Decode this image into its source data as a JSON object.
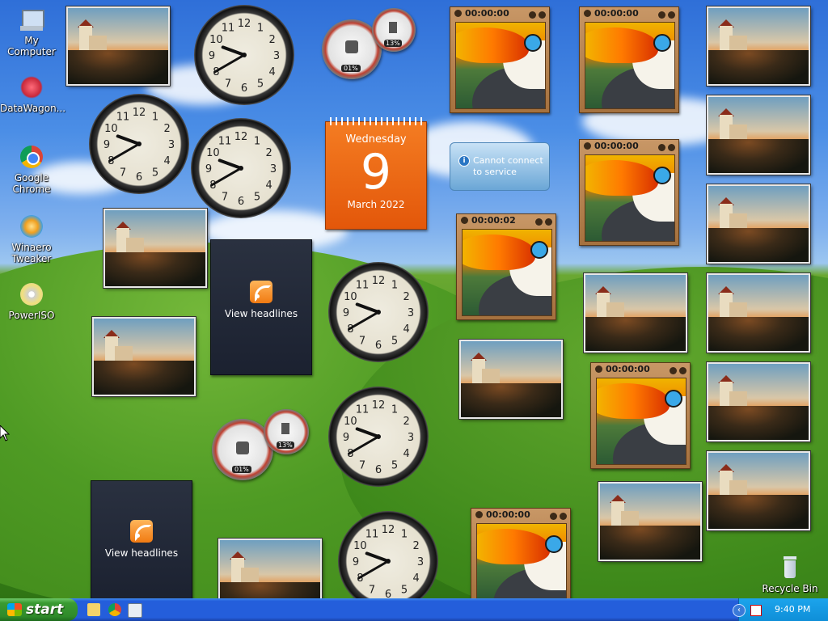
{
  "desktop_icons": [
    {
      "label": "My Computer",
      "icon": "my-computer-icon"
    },
    {
      "label": "DataWagon...",
      "icon": "datawagon-icon"
    },
    {
      "label": "Google Chrome",
      "icon": "chrome-icon"
    },
    {
      "label": "Winaero Tweaker",
      "icon": "winaero-tweaker-icon"
    },
    {
      "label": "PowerISO",
      "icon": "poweriso-icon"
    },
    {
      "label": "Recycle Bin",
      "icon": "recycle-bin-icon"
    }
  ],
  "clock_numbers": [
    "12",
    "1",
    "2",
    "3",
    "4",
    "5",
    "6",
    "7",
    "8",
    "9",
    "10",
    "11"
  ],
  "calendar": {
    "weekday": "Wednesday",
    "day": "9",
    "month_year": "March 2022"
  },
  "cpu_meter": {
    "cpu": "01%",
    "memory": "13%"
  },
  "slideshow": {
    "times": [
      "00:00:00",
      "00:00:00",
      "00:00:00",
      "00:00:02",
      "00:00:00",
      "00:00:00"
    ]
  },
  "weather_widget": {
    "message": "Cannot connect to service",
    "icon": "info-icon"
  },
  "feed_headlines": {
    "label": "View headlines",
    "icon": "rss-icon"
  },
  "taskbar": {
    "start_label": "start",
    "time": "9:40 PM"
  },
  "colors": {
    "taskbar": "#245edb",
    "start_button": "#3a9b32",
    "calendar": "#e86a12",
    "tray": "#0f8fd8"
  }
}
